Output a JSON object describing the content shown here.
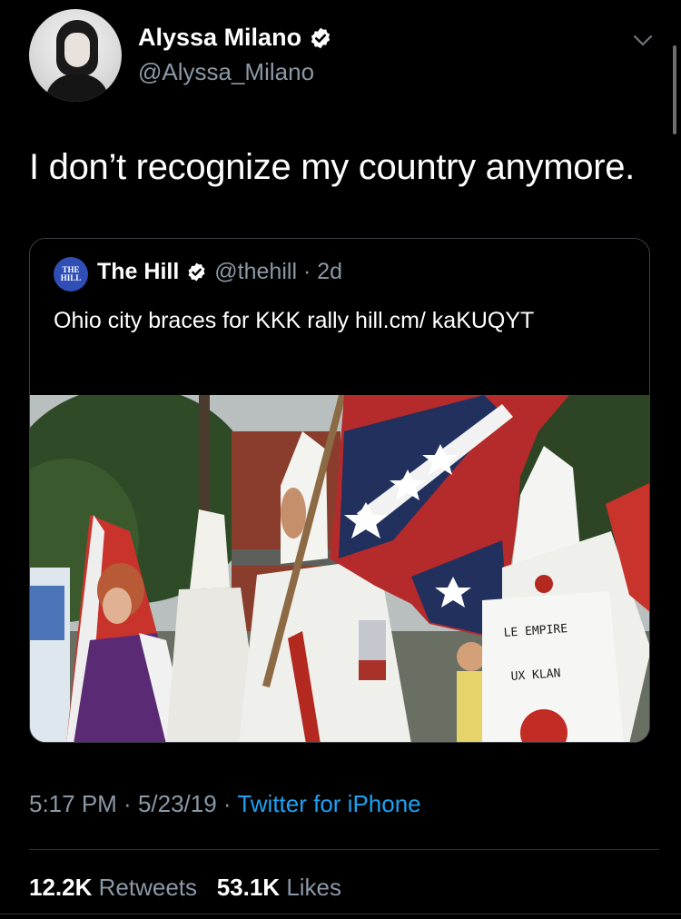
{
  "tweet": {
    "author": {
      "name": "Alyssa Milano",
      "handle": "@Alyssa_Milano",
      "verified": true,
      "avatar_icon": "profile-photo"
    },
    "text": "I don’t recognize my country anymore.",
    "menu_icon": "chevron-down-icon",
    "quoted": {
      "logo_text": "THE HILL",
      "name": "The Hill",
      "handle": "@thehill",
      "separator": "·",
      "age": "2d",
      "text": "Ohio city braces for KKK rally hill.cm/ kaKUQYT",
      "image_text": {
        "banner_line1": "LE EMPIRE",
        "banner_line2": "UX KLAN"
      }
    },
    "meta": {
      "time": "5:17 PM",
      "sep1": " · ",
      "date": "5/23/19",
      "sep2": " · ",
      "source": "Twitter for iPhone"
    },
    "stats": {
      "retweets_count": "12.2K",
      "retweets_label": "Retweets",
      "likes_count": "53.1K",
      "likes_label": "Likes"
    }
  },
  "colors": {
    "background": "#000000",
    "primary_text": "#ffffff",
    "secondary_text": "#8b98a5",
    "link": "#1da1f2",
    "verified_badge": "#ffffff",
    "border": "#3a3f44"
  }
}
